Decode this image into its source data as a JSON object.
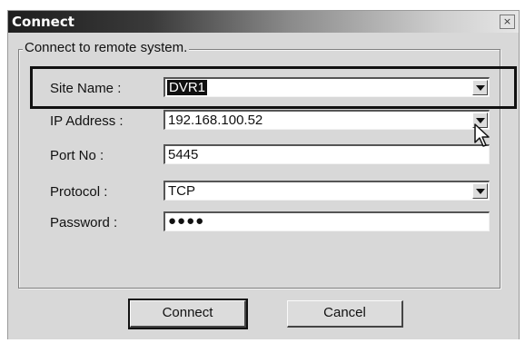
{
  "window": {
    "title": "Connect",
    "close_label": "×"
  },
  "group": {
    "legend": "Connect to remote system."
  },
  "fields": {
    "site_name": {
      "label": "Site Name :",
      "value": "DVR1"
    },
    "ip_address": {
      "label": "IP Address :",
      "value": "192.168.100.52"
    },
    "port_no": {
      "label": "Port No :",
      "value": "5445"
    },
    "protocol": {
      "label": "Protocol :",
      "value": "TCP"
    },
    "password": {
      "label": "Password :",
      "value": "●●●●"
    }
  },
  "buttons": {
    "connect": "Connect",
    "cancel": "Cancel"
  }
}
